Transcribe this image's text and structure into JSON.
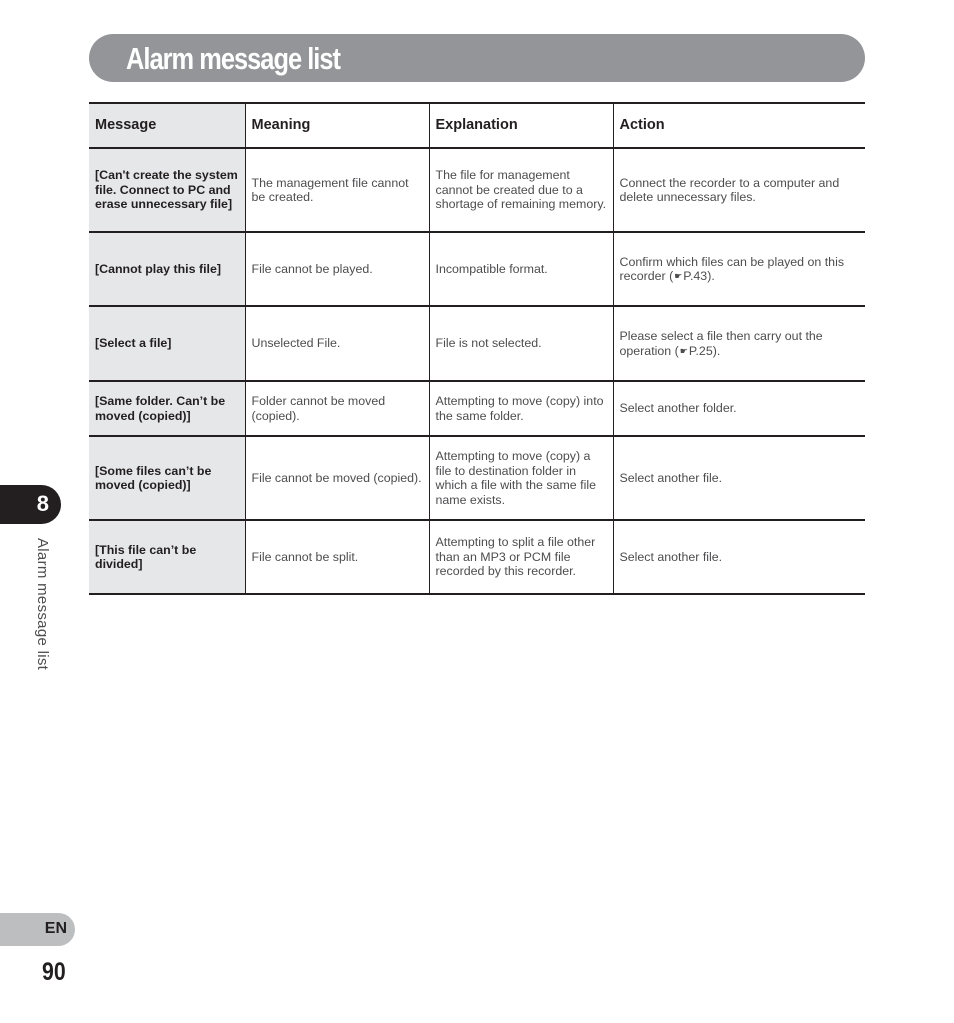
{
  "header": {
    "title": "Alarm message list"
  },
  "table": {
    "columns": [
      "Message",
      "Meaning",
      "Explanation",
      "Action"
    ],
    "rows": [
      {
        "message": "[Can't create the system file. Connect to PC and erase unnecessary file]",
        "meaning": "The management file cannot be created.",
        "explanation": "The file for management cannot be created due to a shortage of remaining memory.",
        "action": "Connect the recorder to a computer and delete unnecessary files."
      },
      {
        "message": "[Cannot play this file]",
        "meaning": "File cannot be played.",
        "explanation": "Incompatible format.",
        "action_before": "Confirm which files can be played on this recorder (",
        "action_ref_icon": "reference-pointer-icon",
        "action_ref": "P.43",
        "action_after": ")."
      },
      {
        "message": "[Select a file]",
        "meaning": "Unselected File.",
        "explanation": "File is not selected.",
        "action_before": "Please select a file then carry out the operation (",
        "action_ref_icon": "reference-pointer-icon",
        "action_ref": "P.25",
        "action_after": ")."
      },
      {
        "message": "[Same folder. Can’t be moved (copied)]",
        "meaning": "Folder cannot be moved (copied).",
        "explanation": "Attempting to move (copy) into the same folder.",
        "action": "Select another folder."
      },
      {
        "message": "[Some files can’t be moved (copied)]",
        "meaning": "File cannot be moved (copied).",
        "explanation": "Attempting to move (copy) a file to destination folder in which a file with the same file name exists.",
        "action": "Select another file."
      },
      {
        "message": "[This file can’t be divided]",
        "meaning": "File cannot be split.",
        "explanation": "Attempting to split a file other than an MP3 or PCM file recorded by this recorder.",
        "action": "Select another file."
      }
    ]
  },
  "side": {
    "chapter_number": "8",
    "chapter_label": "Alarm message list",
    "language": "EN",
    "page_number": "90"
  },
  "colors": {
    "title_bar": "#939598",
    "message_column_bg": "#e6e7e8",
    "chapter_tab": "#231f20",
    "language_tab": "#bcbec0",
    "text": "#231f20"
  }
}
